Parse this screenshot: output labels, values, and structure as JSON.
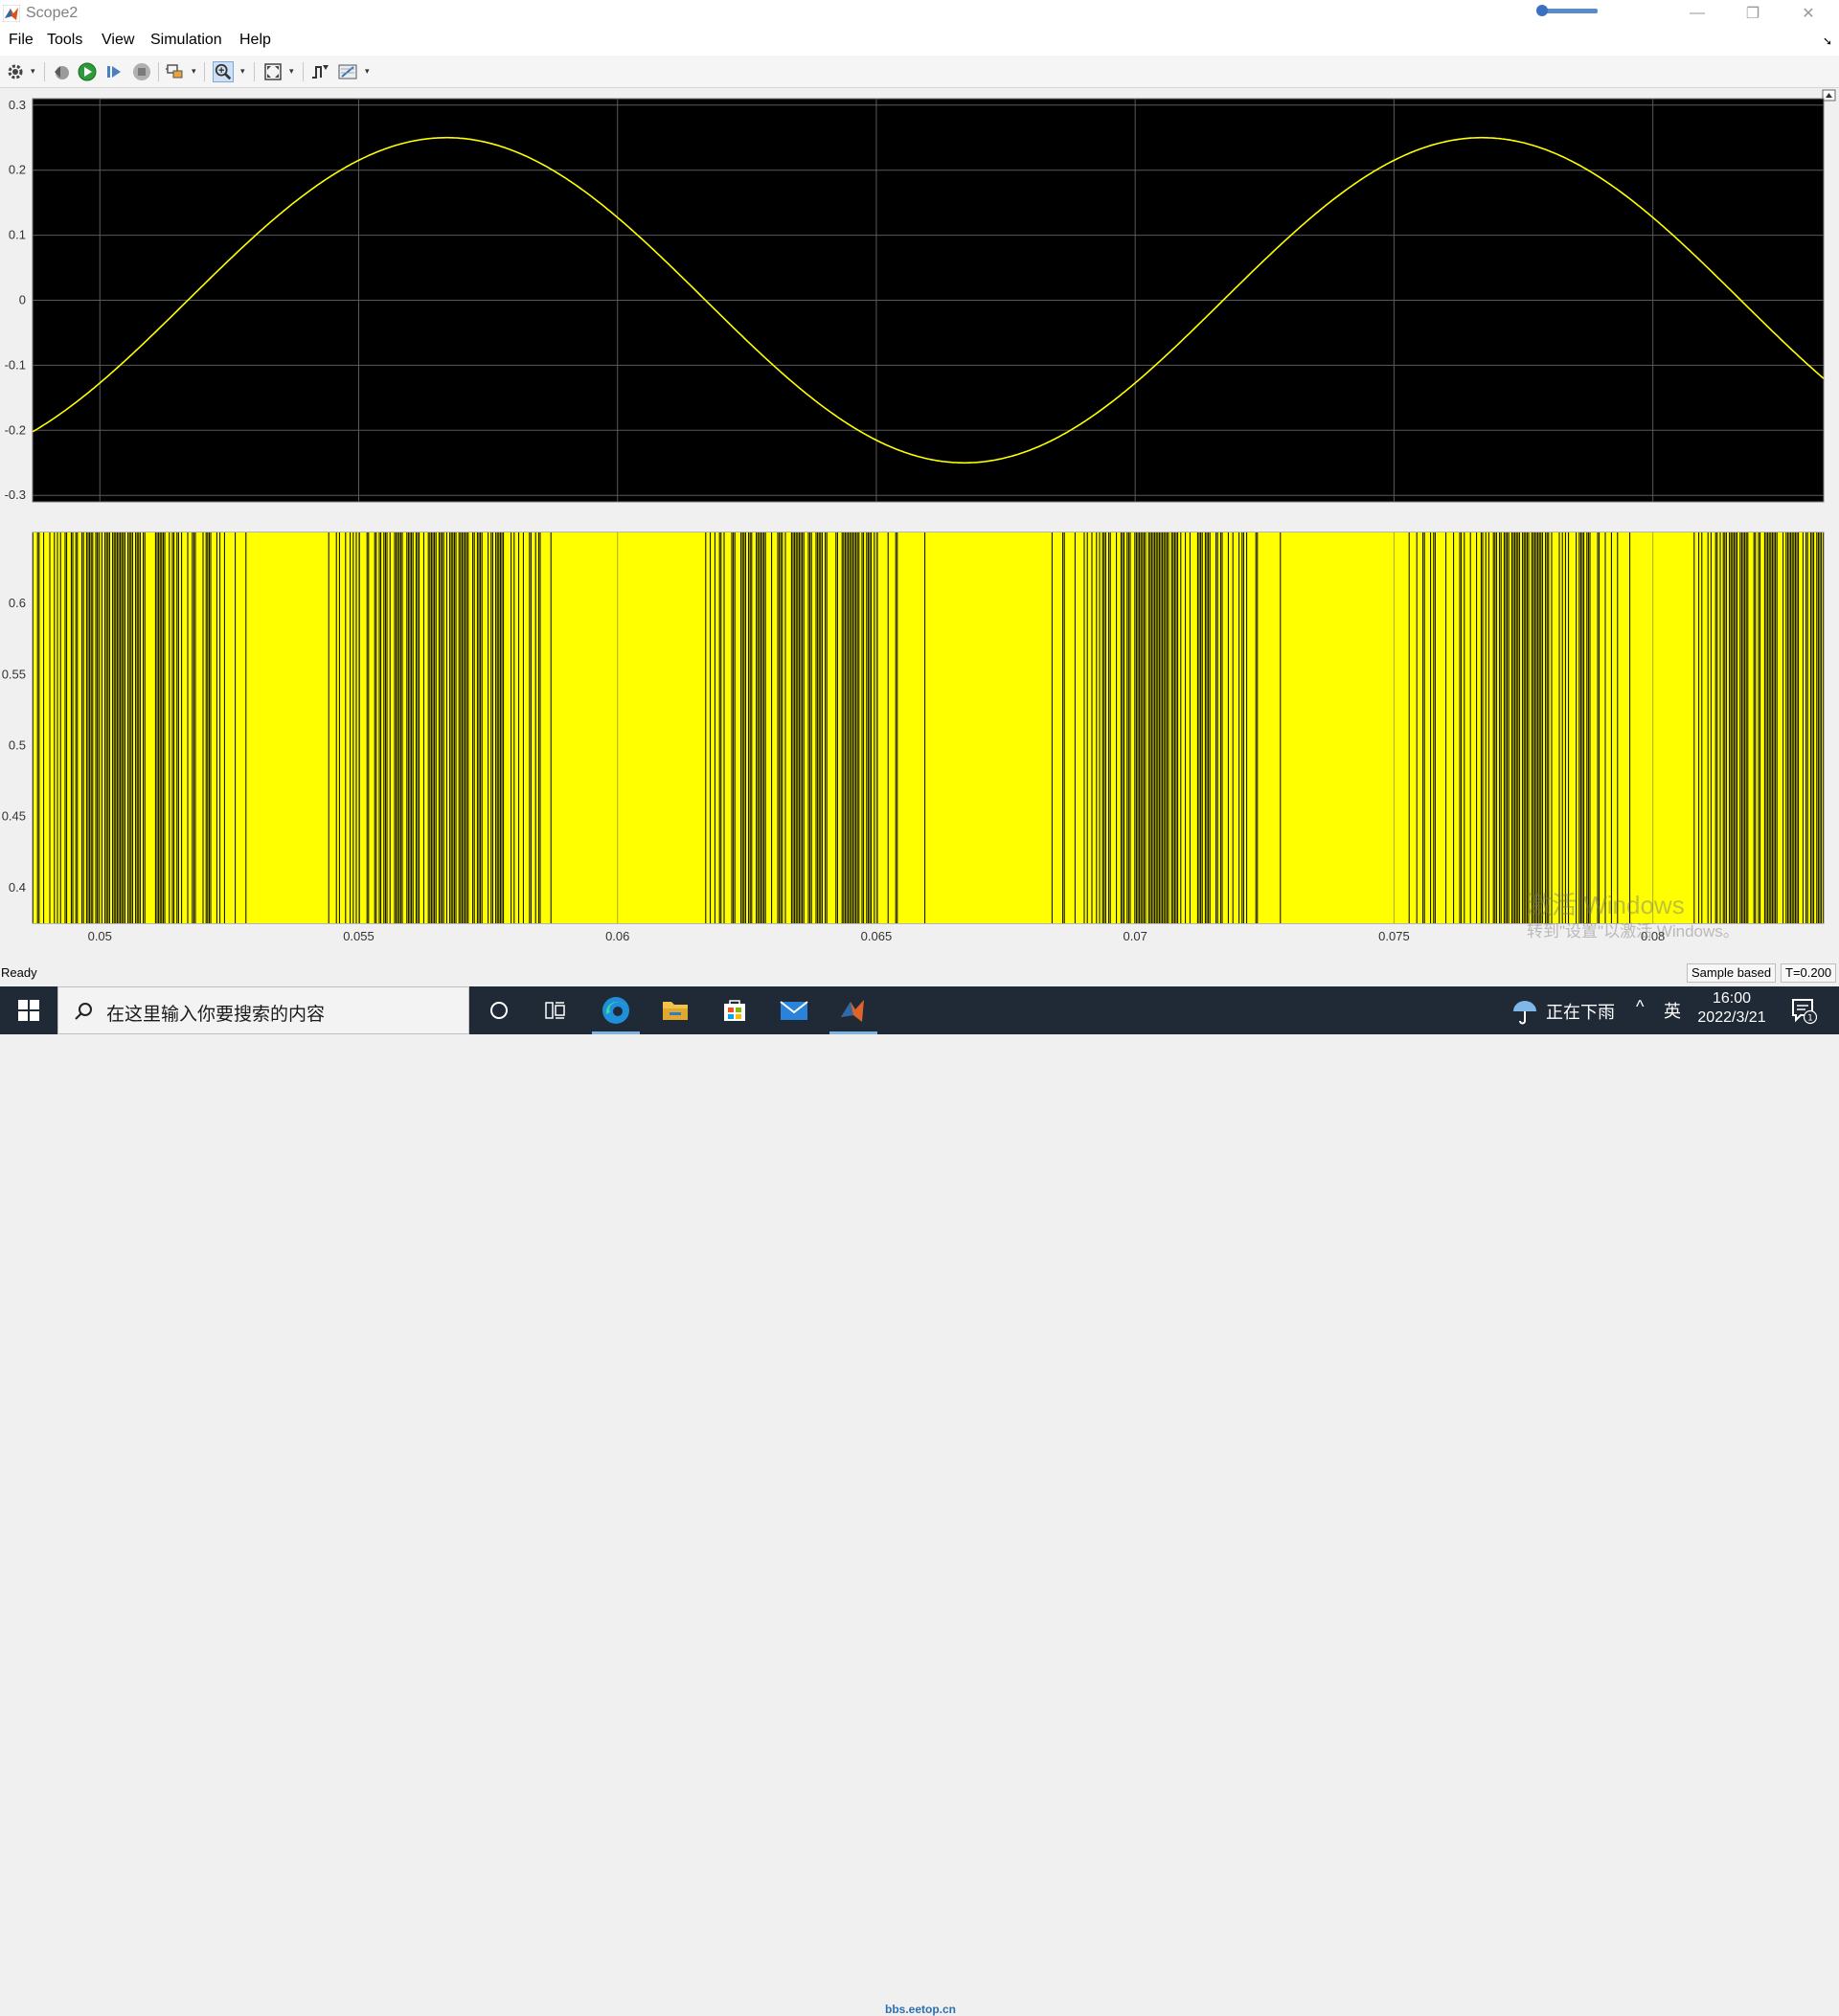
{
  "window": {
    "title": "Scope2",
    "minimize_label": "—",
    "restore_label": "❐",
    "close_label": "✕"
  },
  "menu": {
    "items": [
      "File",
      "Tools",
      "View",
      "Simulation",
      "Help"
    ]
  },
  "toolbar": {
    "icons": [
      "gear-icon",
      "step-back-icon",
      "run-icon",
      "step-forward-icon",
      "stop-icon",
      "highlight-icon",
      "zoom-in-icon",
      "fit-to-view-icon",
      "trigger-icon",
      "measurement-icon"
    ]
  },
  "scope": {
    "background": "#000000",
    "trace_color": "#ffff00",
    "grid_color": "#5a5a5a",
    "x_ticks": [
      "0.05",
      "0.055",
      "0.06",
      "0.065",
      "0.07",
      "0.075",
      "0.08"
    ],
    "top_y_ticks": [
      "0.3",
      "0.2",
      "0.1",
      "0",
      "-0.1",
      "-0.2",
      "-0.3"
    ],
    "bottom_y_ticks": [
      "0.6",
      "0.55",
      "0.5",
      "0.45",
      "0.4"
    ]
  },
  "chart_data": [
    {
      "type": "line",
      "x_range": [
        0.0487,
        0.0833
      ],
      "ylim": [
        -0.31,
        0.31
      ],
      "series": [
        {
          "color": "#ffff00",
          "function": "sine",
          "amplitude": 0.25,
          "period": 0.02,
          "peak_x": 0.0567
        }
      ],
      "grid": true
    },
    {
      "type": "area",
      "x_range": [
        0.0487,
        0.0833
      ],
      "ylim": [
        0.375,
        0.65
      ],
      "series": [
        {
          "color": "#ffff00",
          "levels": [
            0.375,
            0.65
          ],
          "dense_switching_centers": [
            0.0505,
            0.0565,
            0.0636,
            0.0705,
            0.0775,
            0.0826
          ]
        }
      ],
      "grid": false
    }
  ],
  "status": {
    "ready": "Ready",
    "mode": "Sample based",
    "time": "T=0.200"
  },
  "taskbar": {
    "search_placeholder": "在这里输入你要搜索的内容",
    "weather": "正在下雨",
    "chevron": "^",
    "ime": "英",
    "time": "16:00",
    "date": "2022/3/21",
    "notify_count": "1",
    "bbs_mark": "bbs.eetop.cn"
  },
  "watermark": {
    "line1": "激活 Windows",
    "line2": "转到\"设置\"以激活 Windows。"
  }
}
